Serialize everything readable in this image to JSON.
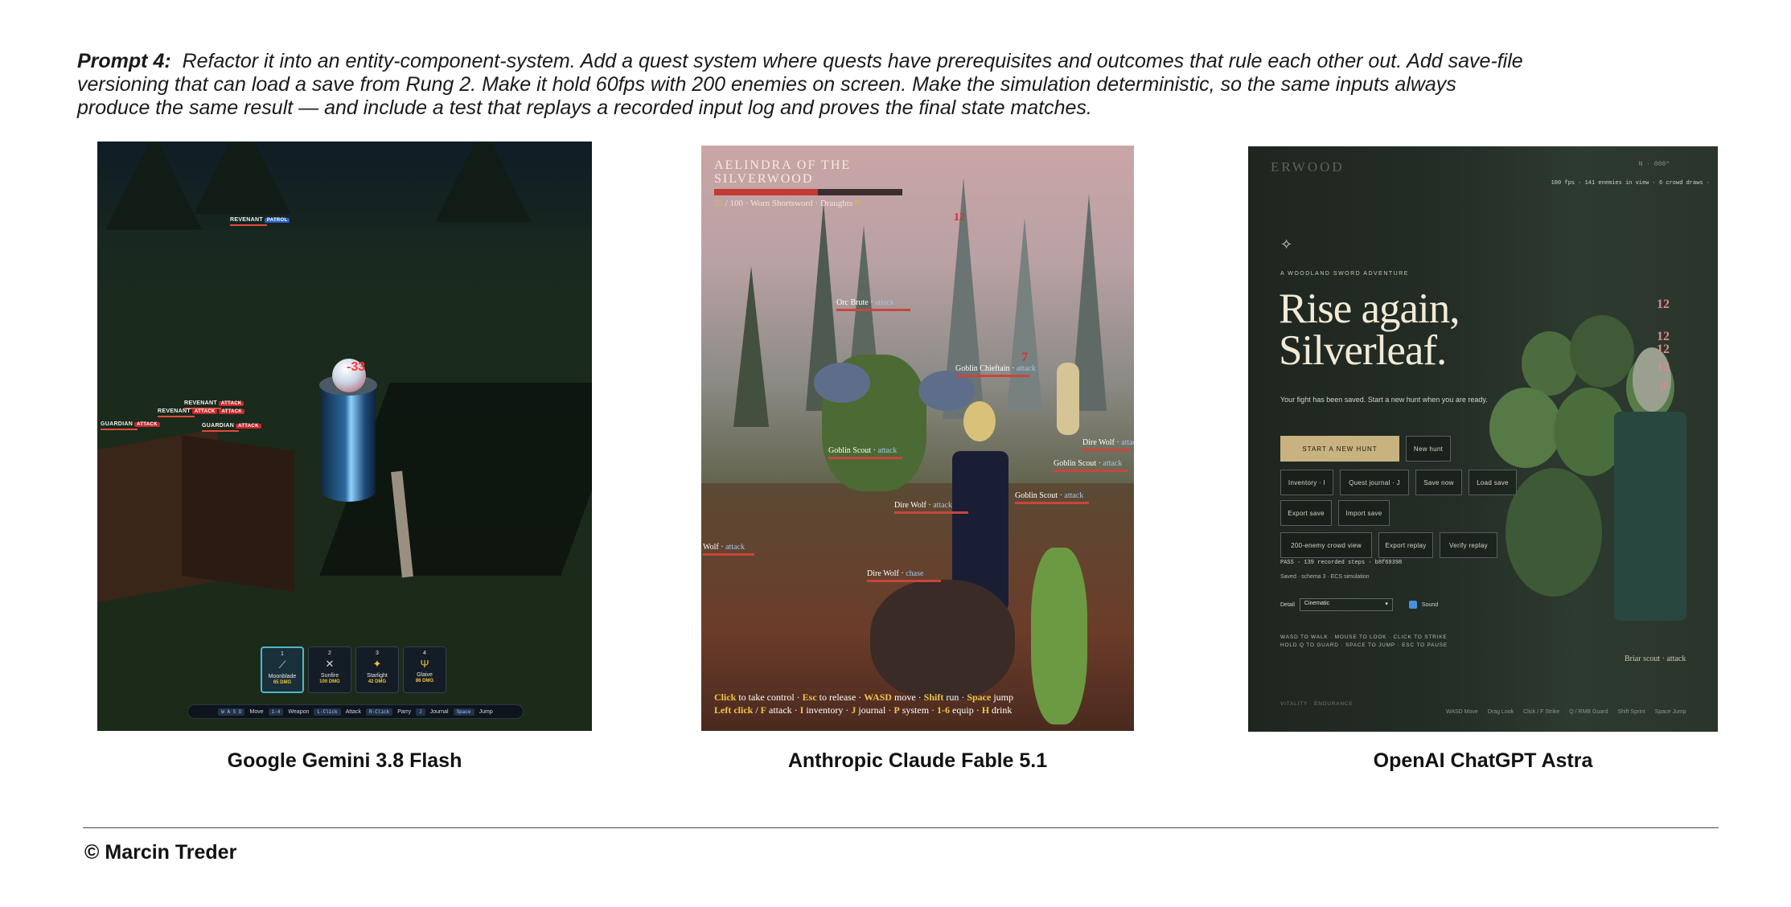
{
  "prompt": {
    "label": "Prompt 4:",
    "text": "Refactor it into an entity-component-system. Add a quest system where quests have prerequisites and outcomes that rule each other out. Add save-file versioning that can load a save from Rung 2. Make it hold 60fps with 200 enemies on screen. Make the simulation deterministic, so the same inputs always produce the same result — and include a test that replays a recorded input log and proves the final state matches."
  },
  "captions": {
    "gemini": "Google Gemini 3.8 Flash",
    "claude": "Anthropic Claude Fable 5.1",
    "chatgpt": "OpenAI ChatGPT Astra"
  },
  "gemini": {
    "enemy_labels": [
      {
        "name": "REVENANT",
        "tag": "PATROL"
      },
      {
        "name": "REVENANT",
        "tag": "ATTACK"
      },
      {
        "name": "REVENANT",
        "tag": "ATTACK"
      },
      {
        "name": "GUARDIAN",
        "tag": "ATTACK"
      },
      {
        "name": "GUARDIAN",
        "tag": "ATTACK"
      }
    ],
    "damage_float": "-33",
    "hotbar": [
      {
        "key": "1",
        "name": "Moonblade",
        "dmg": "65 DMG",
        "icon": "sword-icon"
      },
      {
        "key": "2",
        "name": "Sunfire",
        "dmg": "100 DMG",
        "icon": "crossed-swords-icon"
      },
      {
        "key": "3",
        "name": "Starlight",
        "dmg": "42 DMG",
        "icon": "star-wand-icon"
      },
      {
        "key": "4",
        "name": "Glaive",
        "dmg": "86 DMG",
        "icon": "trident-icon"
      }
    ],
    "controls": [
      {
        "key": "W A S D",
        "action": "Move"
      },
      {
        "key": "1-4",
        "action": "Weapon"
      },
      {
        "key": "L-Click",
        "action": "Attack"
      },
      {
        "key": "R-Click",
        "action": "Parry"
      },
      {
        "key": "J",
        "action": "Journal"
      },
      {
        "key": "Space",
        "action": "Jump"
      }
    ],
    "colors": {
      "tag_attack": "#c8282e",
      "tag_patrol": "#2b63c4",
      "hotbar_active": "#4fb7c9"
    }
  },
  "claude": {
    "title_line1": "AELINDRA OF THE",
    "title_line2": "SILVERWOOD",
    "hp_fraction": 0.55,
    "hp_current": "55",
    "hp_text": " / 100 · Worn Shortsword · Draughts ",
    "draughts": "0",
    "floating_damage": [
      "12",
      "7"
    ],
    "enemies": [
      {
        "name": "Orc Brute",
        "state": "attack"
      },
      {
        "name": "Goblin Chieftain",
        "state": "attack"
      },
      {
        "name": "Goblin Scout",
        "state": "attack"
      },
      {
        "name": "Dire Wolf",
        "state": "attack"
      },
      {
        "name": "Goblin Scout",
        "state": "attack"
      },
      {
        "name": "Goblin Scout",
        "state": "attack"
      },
      {
        "name": "Dire Wolf",
        "state": "attack"
      },
      {
        "name": "Wolf",
        "state": "attack"
      },
      {
        "name": "Dire Wolf",
        "state": "chase"
      }
    ],
    "help_line1": {
      "k1": "Click",
      "t1": " to take control · ",
      "k2": "Esc",
      "t2": " to release · ",
      "k3": "WASD",
      "t3": " move · ",
      "k4": "Shift",
      "t4": " run · ",
      "k5": "Space",
      "t5": " jump"
    },
    "help_line2": {
      "k1": "Left click",
      "t1": " / ",
      "k2": "F",
      "t2": " attack · ",
      "k3": "I",
      "t3": " inventory · ",
      "k4": "J",
      "t4": " journal · ",
      "k5": "P",
      "t5": " system · ",
      "k6": "1-6",
      "t6": " equip · ",
      "k7": "H",
      "t7": " drink"
    }
  },
  "chatgpt": {
    "brand": "ERWOOD",
    "compass": "N · 000°",
    "perf": "100 fps · 141 enemies in view · 6 crowd draws ·",
    "kicker": "A WOODLAND SWORD ADVENTURE",
    "headline_line1": "Rise again,",
    "headline_line2": "Silverleaf.",
    "subtitle": "Your fight has been saved. Start a new hunt when you are ready.",
    "buttons": {
      "start": "START A NEW HUNT",
      "new_hunt": "New hunt",
      "inventory": "Inventory · I",
      "quest_journal": "Quest journal · J",
      "save_now": "Save now",
      "load_save": "Load save",
      "export_save": "Export save",
      "import_save": "Import save",
      "crowd_view": "200-enemy crowd view",
      "export_replay": "Export replay",
      "verify_replay": "Verify replay"
    },
    "replay_status": "PASS · 139 recorded steps · b8f69398",
    "save_status": "Saved · schema 3 · ECS simulation",
    "detail_label": "Detail",
    "detail_value": "Cinematic",
    "sound_label": "Sound",
    "hint_line1": "WASD TO WALK · MOUSE TO LOOK · CLICK TO STRIKE",
    "hint_line2": "HOLD Q TO GUARD · SPACE TO JUMP · ESC TO PAUSE",
    "dim_label1": "VITALITY · ENDURANCE",
    "floating_damage": [
      "12",
      "12",
      "12",
      "12",
      "8"
    ],
    "scout_label": "Briar scout · attack",
    "foot_keys": [
      "WASD Move",
      "Drag Look",
      "Click / F Strike",
      "Q / RMB Guard",
      "Shift Sprint",
      "Space Jump"
    ],
    "colors": {
      "primary_button": "#c8b27f",
      "headline": "#f1ead6"
    }
  },
  "footer": {
    "copyright": "© Marcin Treder"
  }
}
